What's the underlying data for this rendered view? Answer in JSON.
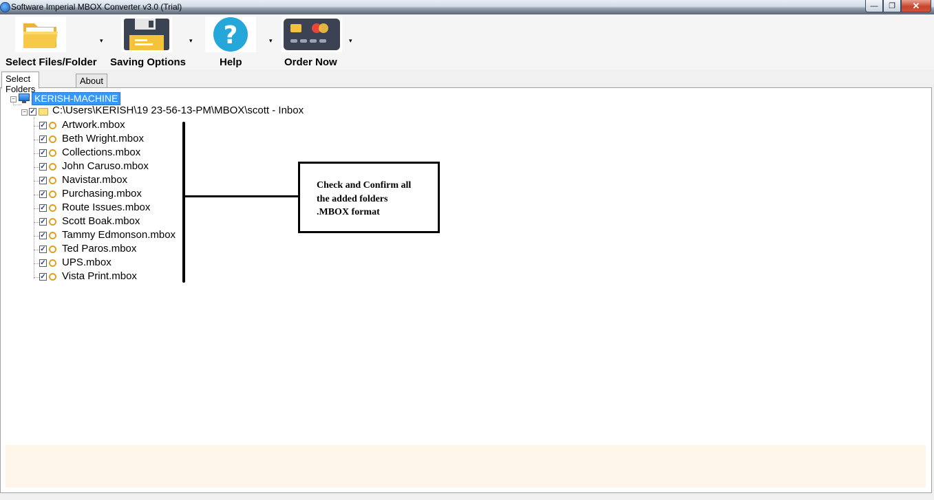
{
  "window": {
    "title": "Software Imperial MBOX Converter v3.0 (Trial)",
    "minimize": "—",
    "maximize": "❐",
    "close": "✕"
  },
  "toolbar": {
    "select_files_label": "Select Files/Folder",
    "saving_options_label": "Saving Options",
    "help_label": "Help",
    "order_now_label": "Order Now",
    "dropdown_glyph": "▾"
  },
  "tabs": {
    "select_folders": "Select Folders",
    "about": "About"
  },
  "tree": {
    "root": "KERISH-MACHINE",
    "path": "C:\\Users\\KERISH\\19 23-56-13-PM\\MBOX\\scott - Inbox",
    "items": [
      "Artwork.mbox",
      "Beth Wright.mbox",
      "Collections.mbox",
      "John Caruso.mbox",
      "Navistar.mbox",
      "Purchasing.mbox",
      "Route Issues.mbox",
      "Scott Boak.mbox",
      "Tammy Edmonson.mbox",
      "Ted Paros.mbox",
      "UPS.mbox",
      "Vista Print.mbox"
    ]
  },
  "callout": {
    "line1": "Check and Confirm all",
    "line2": "the added folders",
    "line3": ".MBOX format"
  },
  "colors": {
    "selection": "#3399ff",
    "footer_bg": "#fdf6e9"
  }
}
